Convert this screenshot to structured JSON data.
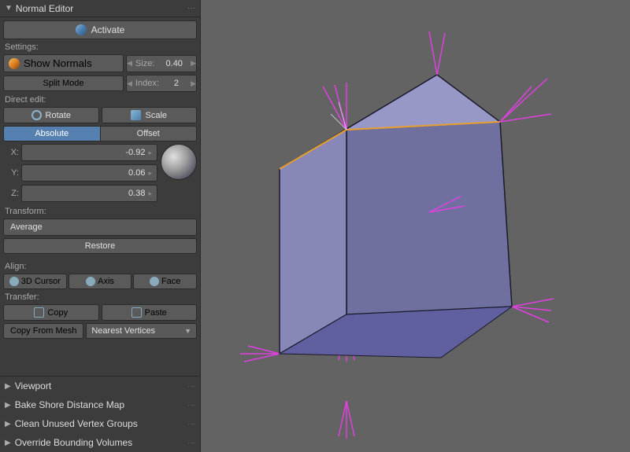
{
  "panel": {
    "title": "Normal Editor",
    "dots": "···"
  },
  "activate": {
    "label": "Activate"
  },
  "settings": {
    "label": "Settings:",
    "show_normals": "Show Normals",
    "size_label": "Size:",
    "size_value": "0.40",
    "split_mode": "Split Mode",
    "index_label": "Index:",
    "index_value": "2"
  },
  "direct_edit": {
    "label": "Direct edit:",
    "rotate": "Rotate",
    "scale": "Scale",
    "absolute": "Absolute",
    "offset": "Offset"
  },
  "coords": {
    "x_label": "X:",
    "x_value": "-0.92",
    "y_label": "Y:",
    "y_value": "0.06",
    "z_label": "Z:",
    "z_value": "0.38"
  },
  "transform": {
    "label": "Transform:",
    "average": "Average",
    "restore": "Restore"
  },
  "align": {
    "label": "Align:",
    "cursor": "3D Cursor",
    "axis": "Axis",
    "face": "Face"
  },
  "transfer": {
    "label": "Transfer:",
    "copy": "Copy",
    "paste": "Paste",
    "copy_from": "Copy From",
    "copy_from_mesh": "Copy From Mesh",
    "nearest_vertices": "Nearest Vertices"
  },
  "sections": [
    {
      "title": "Viewport",
      "collapsed": true
    },
    {
      "title": "Bake Shore Distance Map",
      "collapsed": true
    },
    {
      "title": "Clean Unused Vertex Groups",
      "collapsed": true
    },
    {
      "title": "Override Bounding Volumes",
      "collapsed": true
    }
  ]
}
